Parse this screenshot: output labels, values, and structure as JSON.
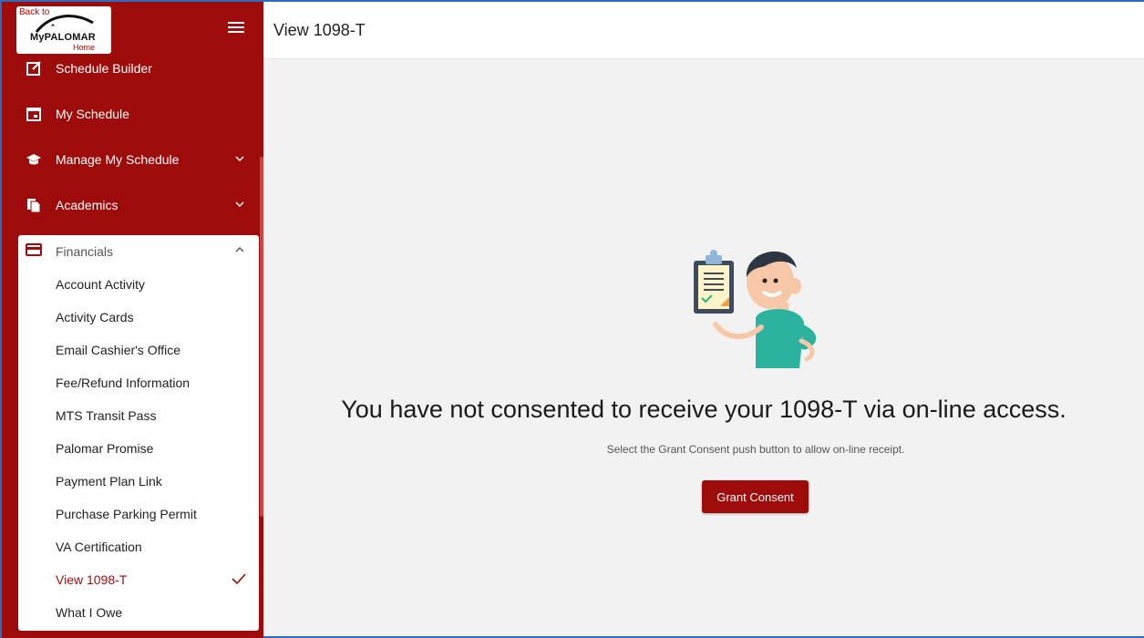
{
  "logo": {
    "back_text": "Back to",
    "brand_text": "MyPALOMAR",
    "home_text": "Home"
  },
  "sidebar": {
    "items": [
      {
        "label": "Schedule Builder"
      },
      {
        "label": "My Schedule"
      },
      {
        "label": "Manage My Schedule"
      },
      {
        "label": "Academics"
      }
    ],
    "financials": {
      "label": "Financials",
      "subitems": [
        {
          "label": "Account Activity"
        },
        {
          "label": "Activity Cards"
        },
        {
          "label": "Email Cashier's Office"
        },
        {
          "label": "Fee/Refund Information"
        },
        {
          "label": "MTS Transit Pass"
        },
        {
          "label": "Palomar Promise"
        },
        {
          "label": "Payment Plan Link"
        },
        {
          "label": "Purchase Parking Permit"
        },
        {
          "label": "VA Certification"
        },
        {
          "label": "View 1098-T"
        },
        {
          "label": "What I Owe"
        }
      ]
    }
  },
  "header": {
    "title": "View 1098-T"
  },
  "main": {
    "message": "You have not consented to receive your 1098-T via on-line access.",
    "instruction": "Select the Grant Consent push button to allow on-line receipt.",
    "button_label": "Grant Consent"
  },
  "colors": {
    "brand": "#9e0b0b",
    "accent_border": "#2f6bbd"
  }
}
